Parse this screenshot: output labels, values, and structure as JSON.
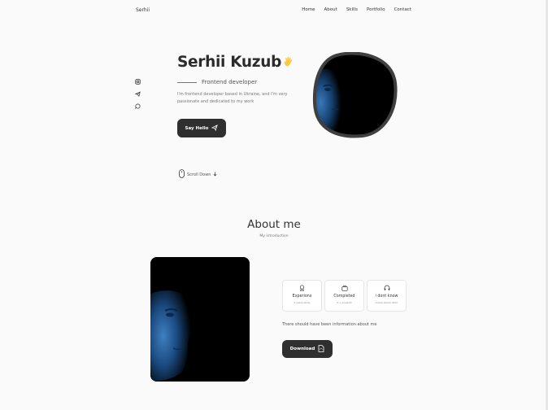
{
  "header": {
    "logo": "Serhii",
    "nav": [
      "Home",
      "About",
      "Skills",
      "Portfolio",
      "Contact"
    ]
  },
  "social": {
    "icons": [
      "instagram-icon",
      "telegram-icon",
      "chat-icon"
    ]
  },
  "hero": {
    "name": "Serhii Kuzub",
    "wave_emoji": "🖐",
    "subtitle": "Frontend developer",
    "description": "I'm frontend developer based in Ukraine, and I'm very passionate and dedicated to my work",
    "button_label": "Say Hello",
    "scroll_label": "Scroll Down"
  },
  "about": {
    "title": "About me",
    "subtitle": "My introduction",
    "cards": [
      {
        "icon": "award-icon",
        "title": "Experions",
        "sub": "1 years study"
      },
      {
        "icon": "briefcase-icon",
        "title": "Completed",
        "sub": "0 + projects"
      },
      {
        "icon": "headset-icon",
        "title": "i dont know",
        "sub": "Lorem ipsum dolor"
      }
    ],
    "text": "There should have been information about me",
    "download_label": "Download"
  },
  "colors": {
    "background": "#fafafa",
    "button": "#2f2f2f",
    "blob_border": "#3f3f3f",
    "portrait_blue": "#1f5a9a"
  }
}
